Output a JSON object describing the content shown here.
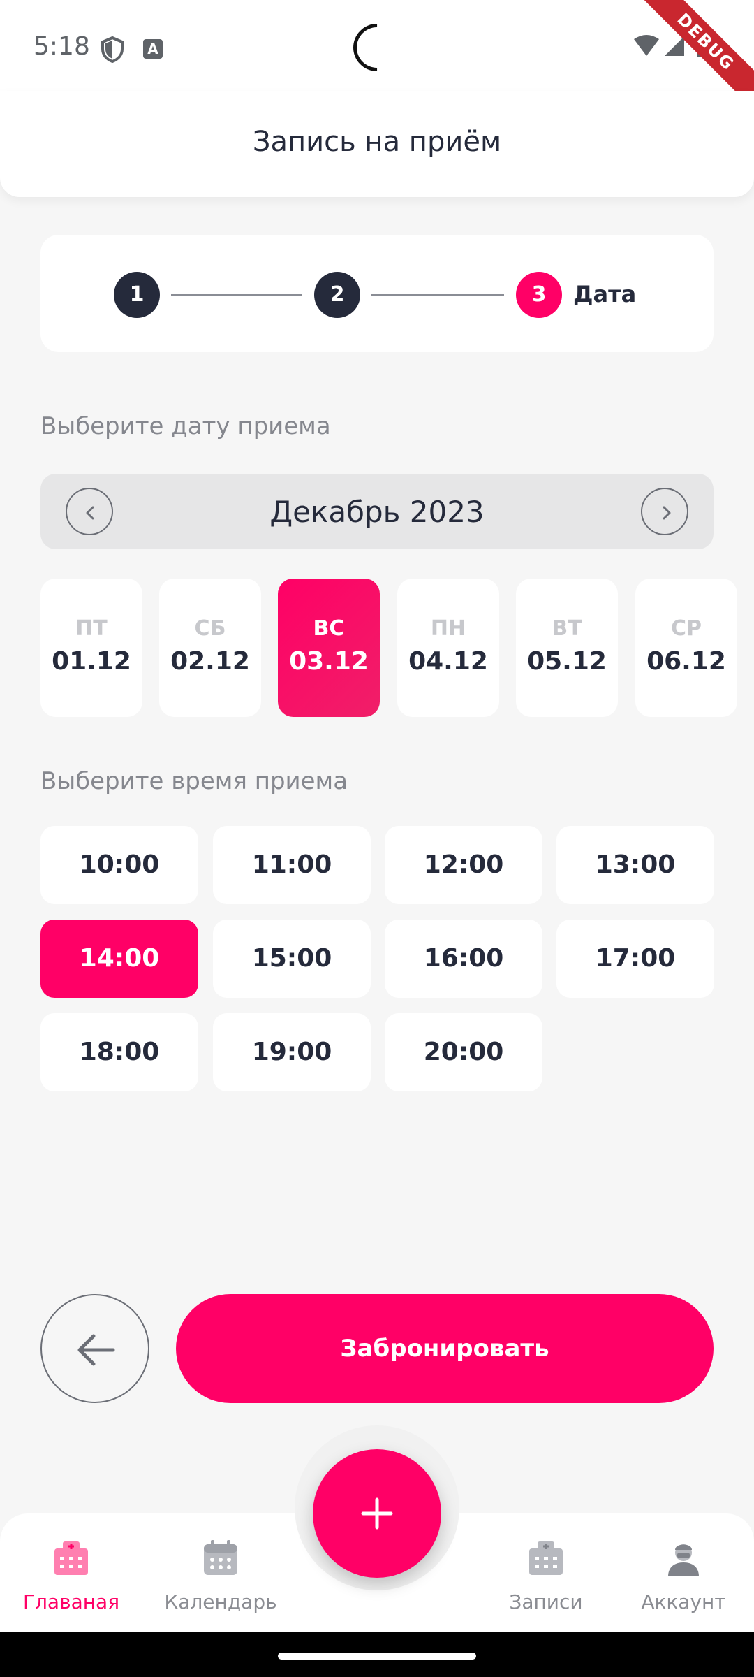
{
  "status_bar": {
    "time": "5:18",
    "debug_label": "DEBUG"
  },
  "app_bar": {
    "title": "Запись на приём"
  },
  "stepper": {
    "steps": [
      {
        "number": "1"
      },
      {
        "number": "2"
      },
      {
        "number": "3",
        "label": "Дата"
      }
    ]
  },
  "date_section": {
    "label": "Выберите дату приема"
  },
  "month_picker": {
    "month": "Декабрь 2023"
  },
  "days": [
    {
      "weekday": "ПТ",
      "date": "01.12"
    },
    {
      "weekday": "СБ",
      "date": "02.12"
    },
    {
      "weekday": "ВС",
      "date": "03.12",
      "selected": true
    },
    {
      "weekday": "ПН",
      "date": "04.12"
    },
    {
      "weekday": "ВТ",
      "date": "05.12"
    },
    {
      "weekday": "СР",
      "date": "06.12"
    }
  ],
  "time_section": {
    "label": "Выберите время приема"
  },
  "times": [
    "10:00",
    "11:00",
    "12:00",
    "13:00",
    "14:00",
    "15:00",
    "16:00",
    "17:00",
    "18:00",
    "19:00",
    "20:00"
  ],
  "selected_time": "14:00",
  "actions": {
    "book_label": "Забронировать"
  },
  "bottom_nav": {
    "items": [
      {
        "label": "Главаная",
        "icon": "hospital-icon",
        "active": true
      },
      {
        "label": "Календарь",
        "icon": "calendar-icon"
      },
      {
        "label": "Записи",
        "icon": "clinic-icon"
      },
      {
        "label": "Аккаунт",
        "icon": "doctor-icon"
      }
    ]
  },
  "colors": {
    "accent": "#ff0066",
    "dark": "#252a3b",
    "muted": "#85878e",
    "background": "#f6f6f6"
  }
}
